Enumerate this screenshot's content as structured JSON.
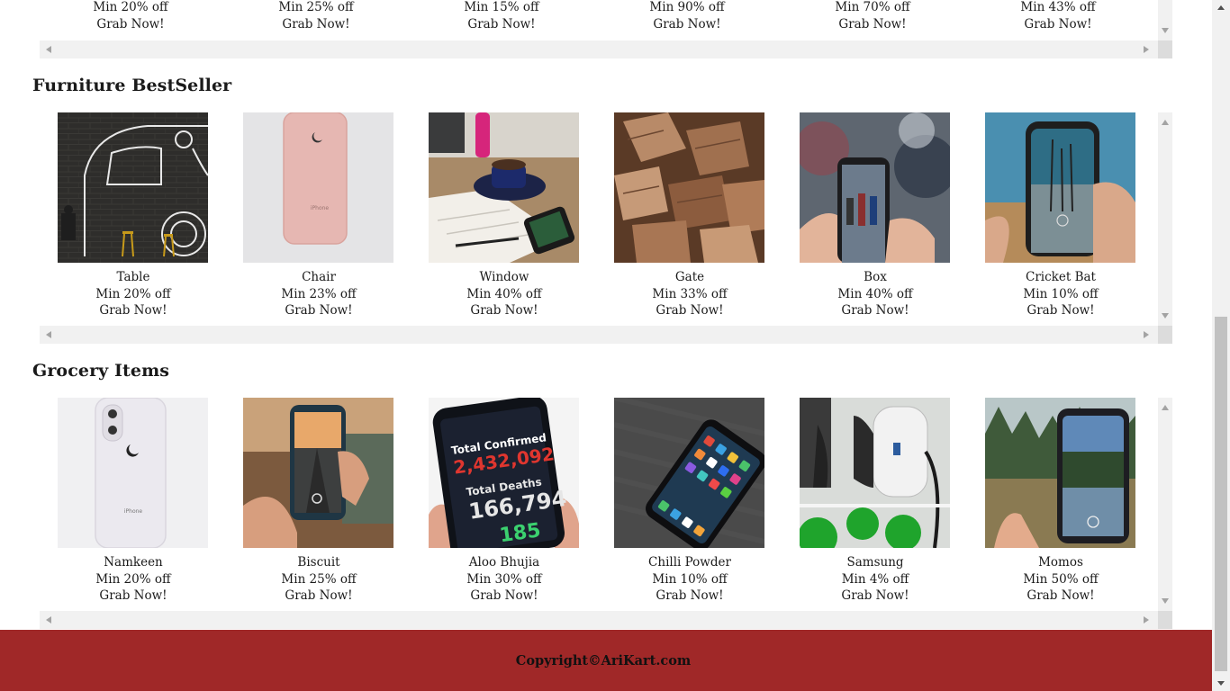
{
  "top_section": {
    "items": [
      {
        "discount": "Min 20% off",
        "cta": "Grab Now!"
      },
      {
        "discount": "Min 25% off",
        "cta": "Grab Now!"
      },
      {
        "discount": "Min 15% off",
        "cta": "Grab Now!"
      },
      {
        "discount": "Min 90% off",
        "cta": "Grab Now!"
      },
      {
        "discount": "Min 70% off",
        "cta": "Grab Now!"
      },
      {
        "discount": "Min 43% off",
        "cta": "Grab Now!"
      }
    ]
  },
  "furniture": {
    "title": "Furniture BestSeller",
    "items": [
      {
        "name": "Table",
        "discount": "Min 20% off",
        "cta": "Grab Now!",
        "image": "van-mural-cafe-image"
      },
      {
        "name": "Chair",
        "discount": "Min 23% off",
        "cta": "Grab Now!",
        "image": "rose-gold-phone-image"
      },
      {
        "name": "Window",
        "discount": "Min 40% off",
        "cta": "Grab Now!",
        "image": "coffee-desk-phone-image"
      },
      {
        "name": "Gate",
        "discount": "Min 33% off",
        "cta": "Grab Now!",
        "image": "chopped-wood-image"
      },
      {
        "name": "Box",
        "discount": "Min 40% off",
        "cta": "Grab Now!",
        "image": "phone-photo-crowd-image"
      },
      {
        "name": "Cricket Bat",
        "discount": "Min 10% off",
        "cta": "Grab Now!",
        "image": "phone-camera-trees-image"
      }
    ]
  },
  "grocery": {
    "title": "Grocery Items",
    "items": [
      {
        "name": "Namkeen",
        "discount": "Min 20% off",
        "cta": "Grab Now!",
        "image": "white-phone-back-image"
      },
      {
        "name": "Biscuit",
        "discount": "Min 25% off",
        "cta": "Grab Now!",
        "image": "phone-photo-street-image"
      },
      {
        "name": "Aloo Bhujia",
        "discount": "Min 30% off",
        "cta": "Grab Now!",
        "image": "phone-covid-stats-image",
        "screen_text": [
          "Total Confirmed",
          "2,432,092",
          "Total Deaths",
          "166,794",
          "185"
        ]
      },
      {
        "name": "Chilli Powder",
        "discount": "Min 10% off",
        "cta": "Grab Now!",
        "image": "phone-on-table-image"
      },
      {
        "name": "Samsung",
        "discount": "Min 4% off",
        "cta": "Grab Now!",
        "image": "ev-charger-image"
      },
      {
        "name": "Momos",
        "discount": "Min 50% off",
        "cta": "Grab Now!",
        "image": "phone-lake-photo-image"
      }
    ]
  },
  "footer": {
    "copyright": "Copyright©AriKart.com"
  },
  "colors": {
    "footer_bg": "#a02828",
    "scrollbar_track": "#f1f1f1",
    "scrollbar_thumb": "#c1c1c1"
  }
}
